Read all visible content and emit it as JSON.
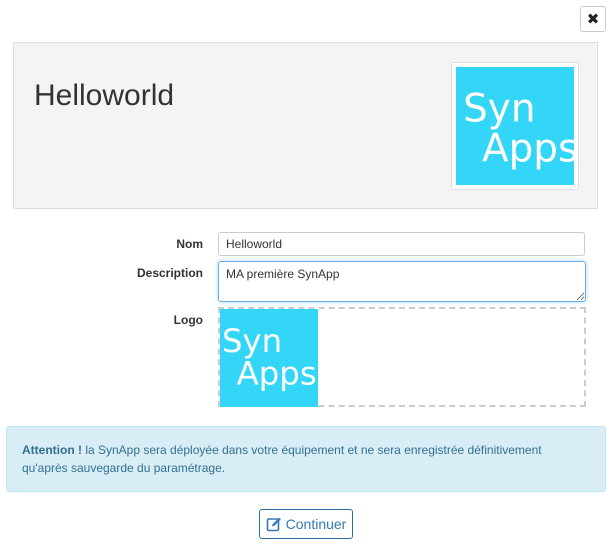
{
  "dialog": {
    "close_glyph": "✖"
  },
  "header": {
    "app_name": "Helloworld",
    "logo_text_line1": "Syn",
    "logo_text_line2": "Apps",
    "logo_color": "#33d6f7"
  },
  "form": {
    "name_label": "Nom",
    "name_value": "Helloworld",
    "description_label": "Description",
    "description_value": "MA première SynApp",
    "logo_label": "Logo"
  },
  "alert": {
    "strong": "Attention !",
    "message": " la SynApp sera déployée dans votre équipement et ne sera enregistrée définitivement qu'après sauvegarde du paramétrage."
  },
  "actions": {
    "continue_label": "Continuer",
    "continue_icon": "edit-icon",
    "accent_color": "#337ab7"
  }
}
